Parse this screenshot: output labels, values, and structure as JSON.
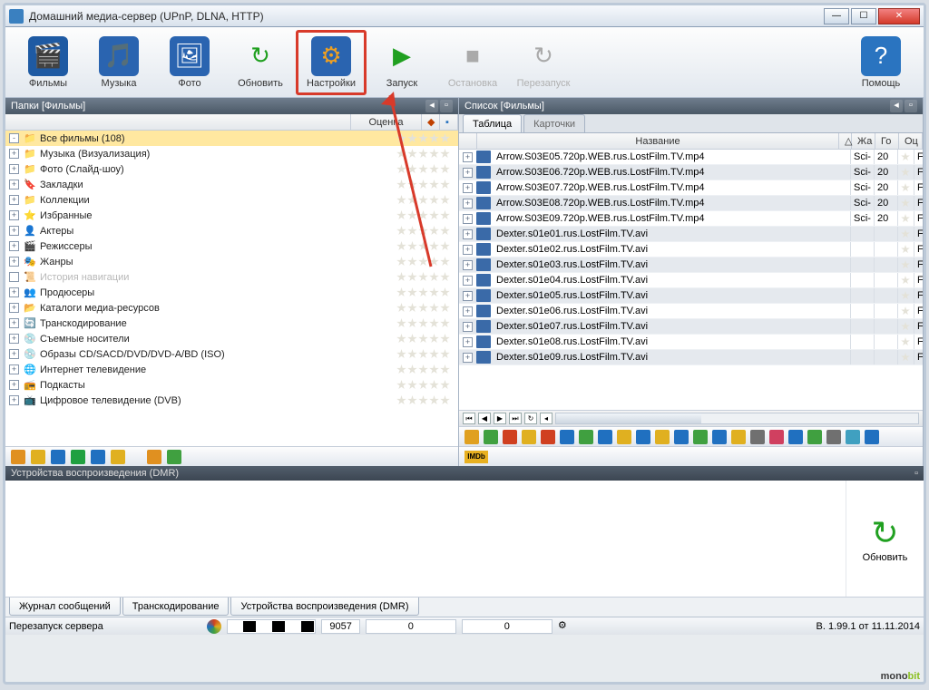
{
  "window": {
    "title": "Домашний медиа-сервер (UPnP, DLNA, HTTP)"
  },
  "toolbar": {
    "movies": "Фильмы",
    "music": "Музыка",
    "photo": "Фото",
    "refresh": "Обновить",
    "settings": "Настройки",
    "start": "Запуск",
    "stop": "Остановка",
    "restart": "Перезапуск",
    "help": "Помощь"
  },
  "left_pane": {
    "header": "Папки [Фильмы]",
    "rating_col": "Оценка",
    "items": [
      {
        "label": "Все фильмы (108)",
        "icon": "📁",
        "selected": true,
        "expand": "-"
      },
      {
        "label": "Музыка (Визуализация)",
        "icon": "📁",
        "expand": "+"
      },
      {
        "label": "Фото (Слайд-шоу)",
        "icon": "📁",
        "expand": "+"
      },
      {
        "label": "Закладки",
        "icon": "🔖",
        "expand": "+"
      },
      {
        "label": "Коллекции",
        "icon": "📁",
        "expand": "+"
      },
      {
        "label": "Избранные",
        "icon": "⭐",
        "expand": "+"
      },
      {
        "label": "Актеры",
        "icon": "👤",
        "expand": "+"
      },
      {
        "label": "Режиссеры",
        "icon": "🎬",
        "expand": "+"
      },
      {
        "label": "Жанры",
        "icon": "🎭",
        "expand": "+"
      },
      {
        "label": "История навигации",
        "icon": "📜",
        "disabled": true,
        "expand": ""
      },
      {
        "label": "Продюсеры",
        "icon": "👥",
        "expand": "+"
      },
      {
        "label": "Каталоги медиа-ресурсов",
        "icon": "📂",
        "expand": "+"
      },
      {
        "label": "Транскодирование",
        "icon": "🔄",
        "expand": "+"
      },
      {
        "label": "Съемные носители",
        "icon": "💿",
        "expand": "+"
      },
      {
        "label": "Образы CD/SACD/DVD/DVD-A/BD (ISO)",
        "icon": "💿",
        "expand": "+"
      },
      {
        "label": "Интернет телевидение",
        "icon": "🌐",
        "expand": "+"
      },
      {
        "label": "Подкасты",
        "icon": "📻",
        "expand": "+"
      },
      {
        "label": "Цифровое телевидение (DVB)",
        "icon": "📺",
        "expand": "+"
      }
    ]
  },
  "right_pane": {
    "header": "Список [Фильмы]",
    "tabs": {
      "table": "Таблица",
      "cards": "Карточки"
    },
    "cols": {
      "name": "Название",
      "genre": "Жа",
      "year": "Го",
      "rating": "Оц"
    },
    "rows": [
      {
        "name": "Arrow.S03E05.720p.WEB.rus.LostFilm.TV.mp4",
        "genre": "Sci-",
        "year": "20",
        "alt": false
      },
      {
        "name": "Arrow.S03E06.720p.WEB.rus.LostFilm.TV.mp4",
        "genre": "Sci-",
        "year": "20",
        "alt": true
      },
      {
        "name": "Arrow.S03E07.720p.WEB.rus.LostFilm.TV.mp4",
        "genre": "Sci-",
        "year": "20",
        "alt": false
      },
      {
        "name": "Arrow.S03E08.720p.WEB.rus.LostFilm.TV.mp4",
        "genre": "Sci-",
        "year": "20",
        "alt": true
      },
      {
        "name": "Arrow.S03E09.720p.WEB.rus.LostFilm.TV.mp4",
        "genre": "Sci-",
        "year": "20",
        "alt": false
      },
      {
        "name": "Dexter.s01e01.rus.LostFilm.TV.avi",
        "genre": "",
        "year": "",
        "alt": true
      },
      {
        "name": "Dexter.s01e02.rus.LostFilm.TV.avi",
        "genre": "",
        "year": "",
        "alt": false
      },
      {
        "name": "Dexter.s01e03.rus.LostFilm.TV.avi",
        "genre": "",
        "year": "",
        "alt": true
      },
      {
        "name": "Dexter.s01e04.rus.LostFilm.TV.avi",
        "genre": "",
        "year": "",
        "alt": false
      },
      {
        "name": "Dexter.s01e05.rus.LostFilm.TV.avi",
        "genre": "",
        "year": "",
        "alt": true
      },
      {
        "name": "Dexter.s01e06.rus.LostFilm.TV.avi",
        "genre": "",
        "year": "",
        "alt": false
      },
      {
        "name": "Dexter.s01e07.rus.LostFilm.TV.avi",
        "genre": "",
        "year": "",
        "alt": true
      },
      {
        "name": "Dexter.s01e08.rus.LostFilm.TV.avi",
        "genre": "",
        "year": "",
        "alt": false
      },
      {
        "name": "Dexter.s01e09.rus.LostFilm.TV.avi",
        "genre": "",
        "year": "",
        "alt": true
      }
    ]
  },
  "dmr": {
    "header": "Устройства воспроизведения (DMR)",
    "refresh": "Обновить"
  },
  "bottom_tabs": {
    "log": "Журнал сообщений",
    "transcode": "Транскодирование",
    "dmr": "Устройства воспроизведения (DMR)"
  },
  "status": {
    "restart": "Перезапуск сервера",
    "val1": "9057",
    "val2": "0",
    "val3": "0",
    "ver": "В. 1.99.1 от 11.11.2014"
  },
  "icons": {
    "movies": "🎬",
    "music": "🎵",
    "photo": "🖼",
    "refresh": "↻",
    "settings": "⚙",
    "play": "▶",
    "stop": "■",
    "restart": "↻",
    "help": "?"
  },
  "watermark": {
    "a": "mono",
    "b": "bit"
  }
}
